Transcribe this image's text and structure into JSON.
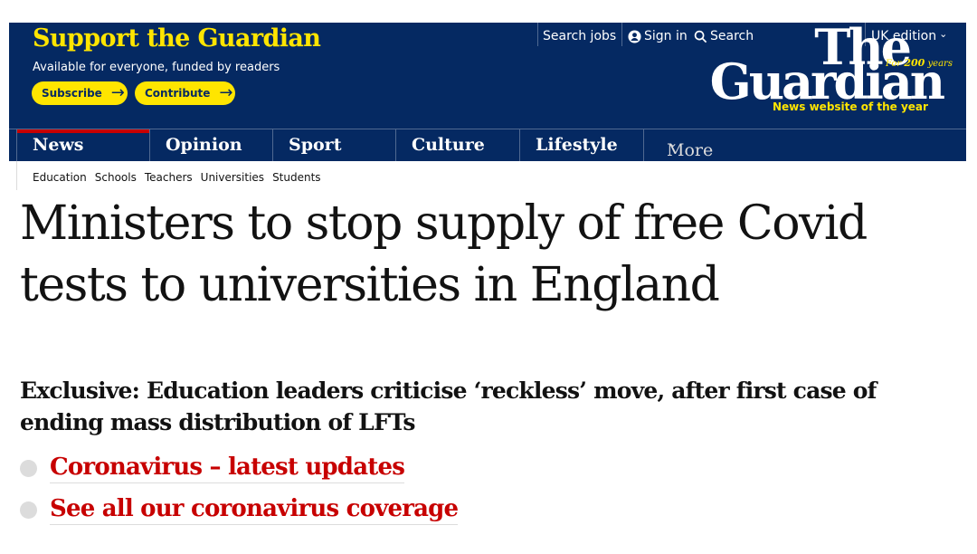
{
  "header": {
    "support_title": "Support the Guardian",
    "support_subtitle": "Available for everyone, funded by readers",
    "subscribe_label": "Subscribe",
    "contribute_label": "Contribute",
    "arrow": "→",
    "top_links": {
      "search_jobs": "Search jobs",
      "sign_in": "Sign in",
      "search": "Search",
      "edition": "UK edition",
      "edition_chevron": "⌄"
    },
    "logo": {
      "line1": "The",
      "line2": "Guardian",
      "for200_prefix": "For ",
      "for200_num": "200",
      "for200_suffix": " years",
      "tagline": "News website of the year"
    },
    "nav": [
      {
        "label": "News"
      },
      {
        "label": "Opinion"
      },
      {
        "label": "Sport"
      },
      {
        "label": "Culture"
      },
      {
        "label": "Lifestyle"
      },
      {
        "label": "More"
      }
    ],
    "more_chevron": "⌄"
  },
  "subnav": [
    "Education",
    "Schools",
    "Teachers",
    "Universities",
    "Students"
  ],
  "article": {
    "headline": "Ministers to stop supply of free Covid tests to universities in England",
    "standfirst": "Exclusive: Education leaders criticise ‘reckless’ move, after first case of ending mass distribution of LFTs",
    "links": [
      "Coronavirus – latest updates",
      "See all our coronavirus coverage"
    ]
  },
  "colors": {
    "brand_blue": "#052962",
    "brand_yellow": "#ffe500",
    "news_red": "#c70000"
  }
}
